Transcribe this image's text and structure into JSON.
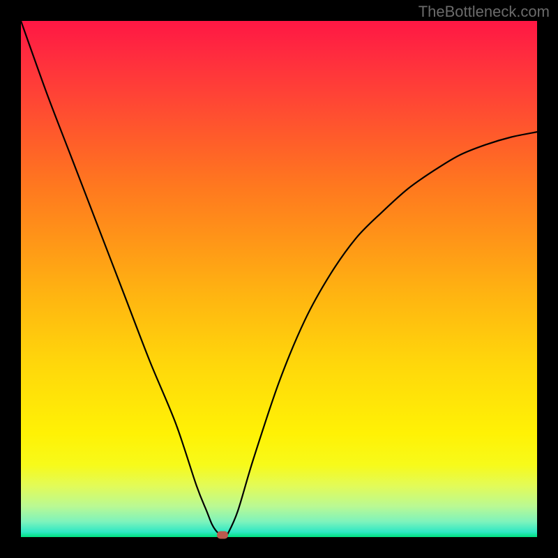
{
  "watermark": "TheBottleneck.com",
  "chart_data": {
    "type": "line",
    "title": "",
    "xlabel": "",
    "ylabel": "",
    "xlim": [
      0,
      100
    ],
    "ylim": [
      0,
      100
    ],
    "series": [
      {
        "name": "curve",
        "x": [
          0,
          5,
          10,
          15,
          20,
          25,
          30,
          34,
          36,
          37,
          38,
          39,
          39.5,
          40,
          42,
          45,
          50,
          55,
          60,
          65,
          70,
          75,
          80,
          85,
          90,
          95,
          100
        ],
        "y": [
          100,
          86,
          73,
          60,
          47,
          34,
          22,
          10,
          5,
          2.5,
          1,
          0.4,
          0.2,
          0.5,
          5,
          15,
          30,
          42,
          51,
          58,
          63,
          67.5,
          71,
          74,
          76,
          77.5,
          78.5
        ]
      }
    ],
    "marker": {
      "x": 39,
      "y": 0.4
    },
    "gradient_stops": [
      {
        "pos": 0,
        "color": "#ff1744"
      },
      {
        "pos": 50,
        "color": "#ffc107"
      },
      {
        "pos": 85,
        "color": "#fff200"
      },
      {
        "pos": 100,
        "color": "#00e17f"
      }
    ]
  }
}
